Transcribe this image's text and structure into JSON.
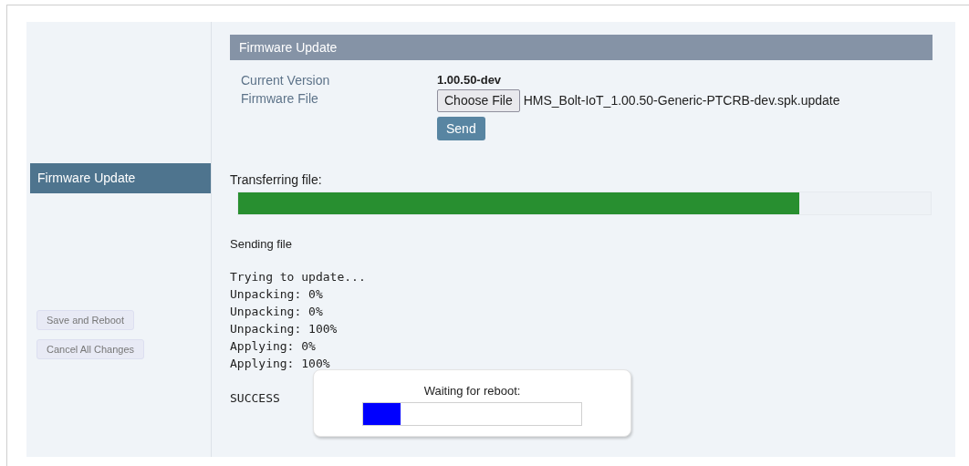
{
  "sidebar": {
    "items": [
      {
        "label": "Firmware Update",
        "selected": true
      }
    ],
    "buttons": [
      {
        "label": "Save and Reboot",
        "disabled": true
      },
      {
        "label": "Cancel All Changes",
        "disabled": true
      }
    ]
  },
  "section": {
    "title": "Firmware Update",
    "fields": [
      {
        "label": "Current Version",
        "value": "1.00.50-dev"
      },
      {
        "label": "Firmware File",
        "button": "Choose File",
        "file_name": "HMS_Bolt-IoT_1.00.50-Generic-PTCRB-dev.spk.update"
      }
    ],
    "send_button": "Send"
  },
  "transfer": {
    "label": "Transferring file:",
    "level": 0.81,
    "status": "Sending file"
  },
  "log": [
    "Trying to update...",
    "Unpacking: 0%",
    "Unpacking: 0%",
    "Unpacking: 100%",
    "Applying: 0%",
    "Applying: 100%"
  ],
  "result": "SUCCESS",
  "reboot_dialog": {
    "label": "Waiting for reboot:",
    "level": 0.17
  }
}
